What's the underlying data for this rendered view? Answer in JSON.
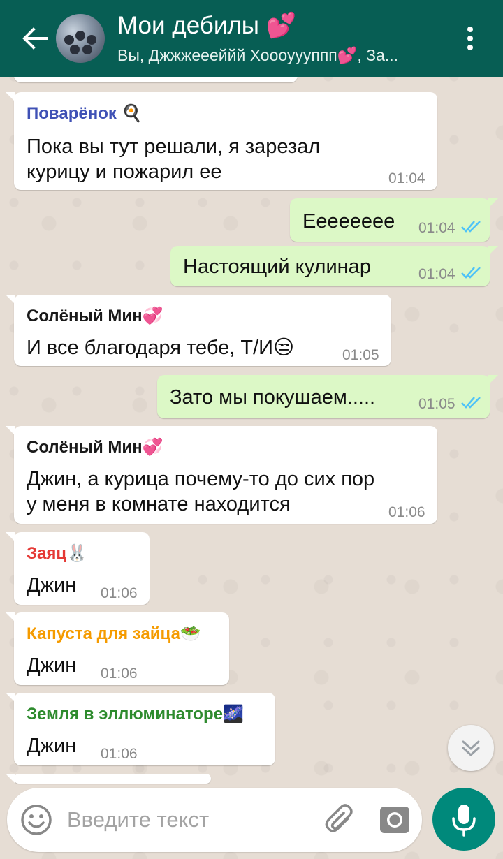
{
  "header": {
    "title": "Мои дебилы 💕",
    "subtitle": "Вы, Джжжеееййй Хоооуууппп💕, За..."
  },
  "messages": [
    {
      "direction": "in",
      "sender": "Поварёнок 🍳",
      "sender_color": "#3f51b5",
      "lines": [
        "Пока вы тут решали, я зарезал",
        "курицу и пожарил ее"
      ],
      "time": "01:04"
    },
    {
      "direction": "out",
      "lines": [
        "Ееееееее"
      ],
      "time": "01:04",
      "status": "read"
    },
    {
      "direction": "out",
      "lines": [
        "Настоящий кулинар"
      ],
      "time": "01:04",
      "status": "read"
    },
    {
      "direction": "in",
      "sender": "Солёный Мин💞",
      "sender_color": "#1a1a1a",
      "lines": [
        "И все благодаря тебе, Т/И😒"
      ],
      "time": "01:05"
    },
    {
      "direction": "out",
      "lines": [
        "Зато мы покушаем....."
      ],
      "time": "01:05",
      "status": "read"
    },
    {
      "direction": "in",
      "sender": "Солёный Мин💞",
      "sender_color": "#1a1a1a",
      "lines": [
        "Джин, а курица почему-то до сих пор",
        "у меня в комнате находится"
      ],
      "time": "01:06"
    },
    {
      "direction": "in",
      "sender": "Заяц🐰",
      "sender_color": "#e53935",
      "lines": [
        "Джин"
      ],
      "time": "01:06"
    },
    {
      "direction": "in",
      "sender": "Капуста для зайца🥗",
      "sender_color": "#f59b00",
      "lines": [
        "Джин"
      ],
      "time": "01:06"
    },
    {
      "direction": "in",
      "sender": "Земля в эллюминаторе🌌",
      "sender_color": "#2e8b2e",
      "lines": [
        "Джин"
      ],
      "time": "01:06"
    }
  ],
  "input": {
    "placeholder": "Введите текст"
  },
  "icons": {
    "back": "arrow-left-icon",
    "menu": "more-vert-icon",
    "emoji": "smiley-icon",
    "attach": "paperclip-icon",
    "camera": "camera-icon",
    "mic": "microphone-icon",
    "scroll_down": "chevron-double-down-icon",
    "read_receipt": "double-check-icon"
  },
  "colors": {
    "header": "#075e54",
    "outgoing_bubble": "#dcf8c6",
    "incoming_bubble": "#ffffff",
    "read_ticks": "#4fc3f7",
    "mic_button": "#00897b"
  }
}
